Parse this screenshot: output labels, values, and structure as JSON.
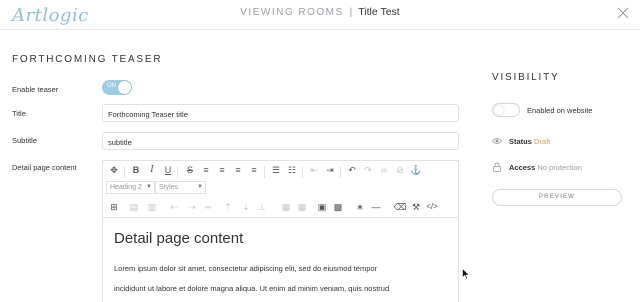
{
  "header": {
    "logo": "Artlogic",
    "section": "VIEWING ROOMS",
    "separator": "|",
    "title": "Title Test"
  },
  "form": {
    "heading": "FORTHCOMING TEASER",
    "enable_teaser": {
      "label": "Enable teaser",
      "toggle_text": "ON",
      "state": "on"
    },
    "title": {
      "label": "Title",
      "value": "Forthcoming Teaser title"
    },
    "subtitle": {
      "label": "Subtitle",
      "value": "subtitle"
    },
    "detail": {
      "label": "Detail page content"
    }
  },
  "editor": {
    "format_select": "Heading 2",
    "styles_select": "Styles",
    "content_heading": "Detail page content",
    "content_lines": [
      "Lorem ipsum dolor sit amet, consectetur adipiscing elit, sed do eiusmod tempor",
      "incididunt ut labore et dolore magna aliqua. Ut enim ad minim veniam, quis nostrud"
    ]
  },
  "visibility": {
    "heading": "VISIBILITY",
    "website_toggle": {
      "label": "Enabled on website",
      "state": "off"
    },
    "status": {
      "label": "Status",
      "value": "Draft"
    },
    "access": {
      "label": "Access",
      "value": "No protection"
    },
    "preview_button": "PREVIEW"
  },
  "colors": {
    "accent": "#9ccbe6",
    "logo": "#8ec0dd",
    "draft": "#c9a25a"
  }
}
